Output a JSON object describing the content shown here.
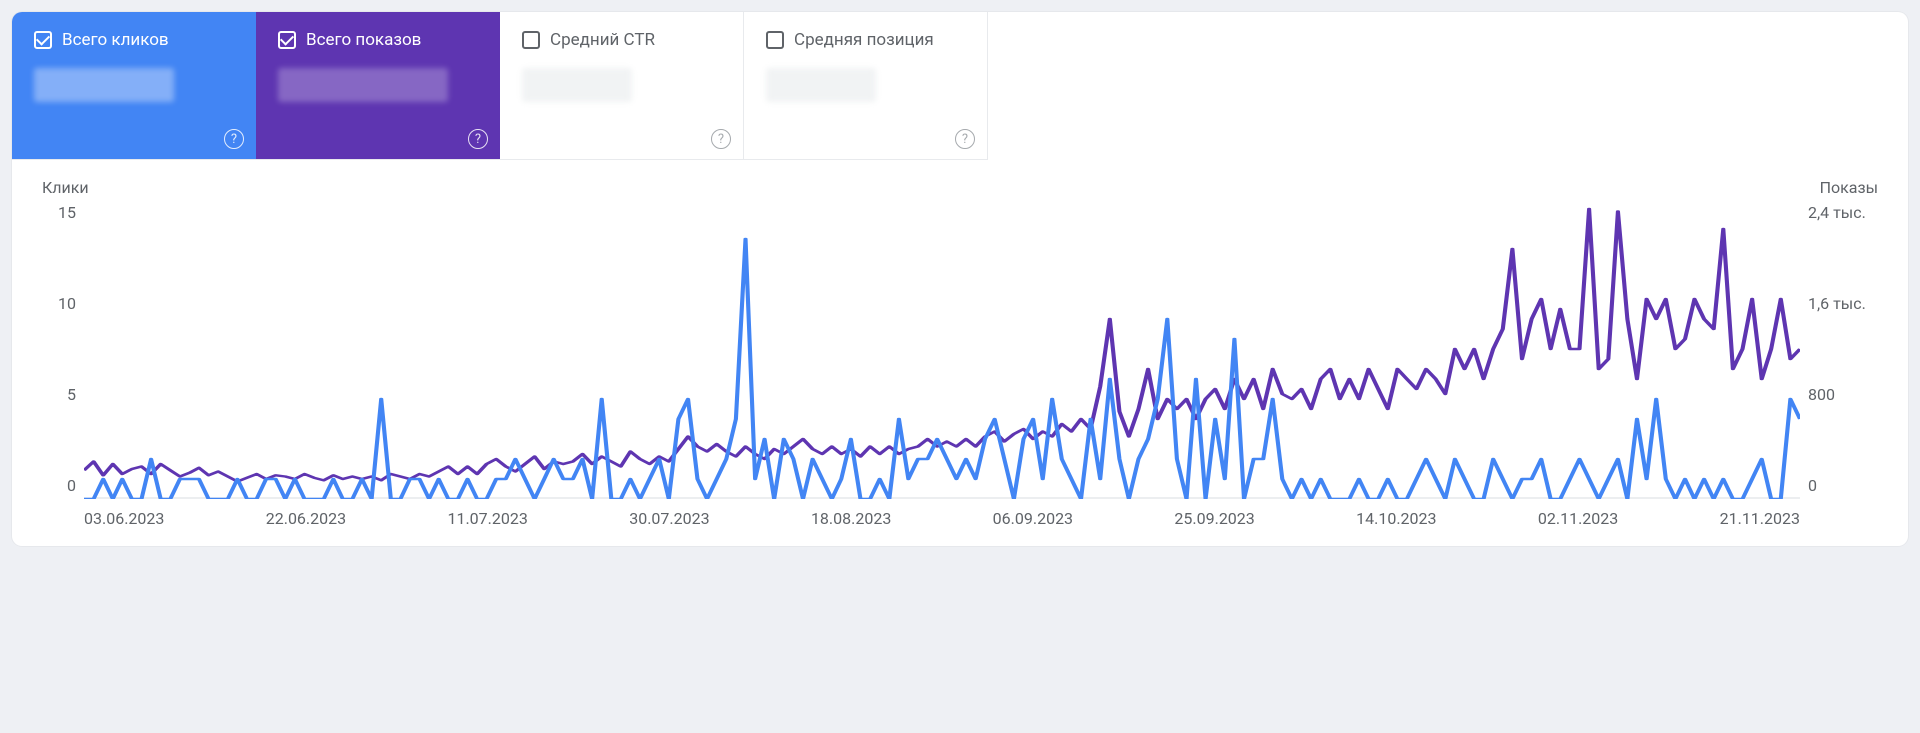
{
  "metrics": [
    {
      "label": "Всего кликов",
      "checked": true,
      "style": "active-blue"
    },
    {
      "label": "Всего показов",
      "checked": true,
      "style": "active-purple"
    },
    {
      "label": "Средний CTR",
      "checked": false,
      "style": ""
    },
    {
      "label": "Средняя позиция",
      "checked": false,
      "style": ""
    }
  ],
  "left_title": "Клики",
  "right_title": "Показы",
  "y_left_ticks": [
    "15",
    "10",
    "5",
    "0"
  ],
  "y_right_ticks": [
    "2,4 тыс.",
    "1,6 тыс.",
    "800",
    "0"
  ],
  "x_ticks": [
    "03.06.2023",
    "22.06.2023",
    "11.07.2023",
    "30.07.2023",
    "18.08.2023",
    "06.09.2023",
    "25.09.2023",
    "14.10.2023",
    "02.11.2023",
    "21.11.2023"
  ],
  "chart_data": {
    "type": "line",
    "xlabel": "",
    "ylabel_left": "Клики",
    "ylabel_right": "Показы",
    "ylim_left": [
      0,
      15
    ],
    "ylim_right": [
      0,
      2400
    ],
    "x_start": "03.06.2023",
    "x_end": "30.11.2023",
    "x_tick_labels": [
      "03.06.2023",
      "22.06.2023",
      "11.07.2023",
      "30.07.2023",
      "18.08.2023",
      "06.09.2023",
      "25.09.2023",
      "14.10.2023",
      "02.11.2023",
      "21.11.2023"
    ],
    "series": [
      {
        "name": "Клики",
        "axis": "left",
        "color": "#4285f4",
        "values": [
          0,
          0,
          1,
          0,
          1,
          0,
          0,
          2,
          0,
          0,
          1,
          1,
          1,
          0,
          0,
          0,
          1,
          0,
          0,
          1,
          1,
          0,
          1,
          0,
          0,
          0,
          1,
          0,
          0,
          1,
          0,
          5,
          0,
          0,
          1,
          1,
          0,
          1,
          0,
          0,
          1,
          0,
          0,
          1,
          1,
          2,
          1,
          0,
          1,
          2,
          1,
          1,
          2,
          0,
          5,
          0,
          0,
          1,
          0,
          1,
          2,
          0,
          4,
          5,
          1,
          0,
          1,
          2,
          4,
          13,
          1,
          3,
          0,
          3,
          2,
          0,
          2,
          1,
          0,
          1,
          3,
          0,
          0,
          1,
          0,
          4,
          1,
          2,
          2,
          3,
          2,
          1,
          2,
          1,
          3,
          4,
          2,
          0,
          3,
          4,
          1,
          5,
          2,
          1,
          0,
          4,
          1,
          6,
          2,
          0,
          2,
          3,
          5,
          9,
          2,
          0,
          6,
          0,
          4,
          1,
          8,
          0,
          2,
          2,
          5,
          1,
          0,
          1,
          0,
          1,
          0,
          0,
          0,
          1,
          0,
          0,
          1,
          0,
          0,
          1,
          2,
          1,
          0,
          2,
          1,
          0,
          0,
          2,
          1,
          0,
          1,
          1,
          2,
          0,
          0,
          1,
          2,
          1,
          0,
          1,
          2,
          0,
          4,
          1,
          5,
          1,
          0,
          1,
          0,
          1,
          0,
          1,
          0,
          0,
          1,
          2,
          0,
          0,
          5,
          4
        ]
      },
      {
        "name": "Показы",
        "axis": "right",
        "color": "#5e35b1",
        "values": [
          230,
          300,
          190,
          280,
          200,
          240,
          260,
          200,
          280,
          230,
          180,
          210,
          250,
          190,
          220,
          180,
          140,
          170,
          200,
          160,
          190,
          180,
          160,
          200,
          170,
          150,
          190,
          160,
          180,
          160,
          180,
          150,
          200,
          180,
          160,
          200,
          180,
          220,
          260,
          200,
          260,
          200,
          280,
          320,
          260,
          220,
          280,
          340,
          240,
          300,
          280,
          300,
          360,
          280,
          340,
          300,
          260,
          380,
          320,
          280,
          340,
          300,
          400,
          500,
          420,
          380,
          440,
          380,
          340,
          420,
          360,
          320,
          400,
          360,
          420,
          480,
          400,
          360,
          420,
          360,
          400,
          340,
          420,
          360,
          420,
          360,
          400,
          420,
          480,
          420,
          460,
          420,
          480,
          420,
          500,
          540,
          460,
          520,
          560,
          480,
          540,
          500,
          600,
          540,
          640,
          560,
          900,
          1440,
          700,
          500,
          720,
          1040,
          640,
          800,
          720,
          800,
          640,
          800,
          880,
          720,
          960,
          800,
          960,
          720,
          1040,
          840,
          800,
          880,
          720,
          960,
          1040,
          800,
          960,
          800,
          1040,
          880,
          720,
          1040,
          960,
          880,
          1040,
          960,
          840,
          1200,
          1040,
          1200,
          960,
          1200,
          1360,
          2000,
          1120,
          1440,
          1600,
          1200,
          1520,
          1200,
          1200,
          2320,
          1040,
          1120,
          2300,
          1440,
          960,
          1600,
          1440,
          1600,
          1200,
          1280,
          1600,
          1440,
          1360,
          2160,
          1040,
          1200,
          1600,
          960,
          1200,
          1600,
          1120,
          1200
        ]
      }
    ]
  }
}
